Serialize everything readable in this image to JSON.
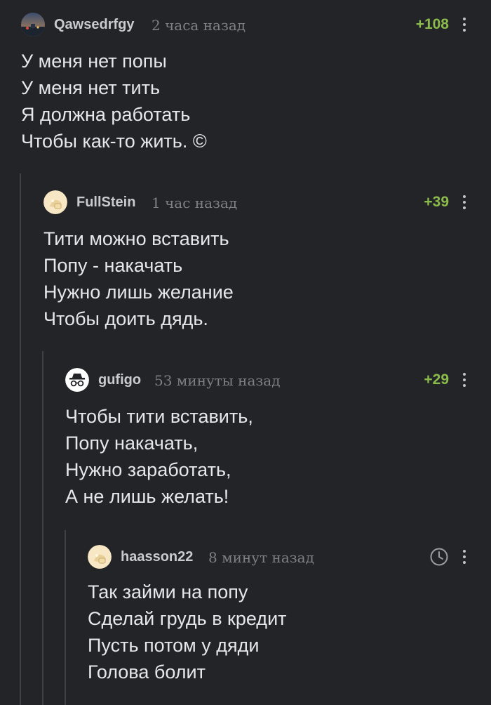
{
  "comments": [
    {
      "username": "Qawsedrfgy",
      "time": "2 часа назад",
      "rating": "+108",
      "lines": [
        "У меня нет попы",
        "У меня нет тить",
        "Я должна работать",
        "Чтобы как-то жить. ©"
      ],
      "avatar": "landscape-avatar"
    },
    {
      "username": "FullStein",
      "time": "1 час назад",
      "rating": "+39",
      "lines": [
        "Тити можно вставить",
        "Попу - накачать",
        "Нужно лишь желание",
        "Чтобы доить дядь."
      ],
      "avatar": "default-avatar"
    },
    {
      "username": "gufigo",
      "time": "53 минуты назад",
      "rating": "+29",
      "lines": [
        "Чтобы тити вставить,",
        "Попу накачать,",
        "Нужно заработать,",
        "А не лишь желать!"
      ],
      "avatar": "incognito-avatar"
    },
    {
      "username": "haasson22",
      "time": "8 минут назад",
      "rating": "",
      "lines": [
        "Так займи на попу",
        "Сделай грудь в кредит",
        "Пусть потом у дяди",
        "Голова болит"
      ],
      "avatar": "default-avatar",
      "pending_icon": "clock-icon"
    }
  ],
  "colors": {
    "background": "#222427",
    "rating": "#8bbb4b",
    "thread_line": "#3e4145"
  }
}
